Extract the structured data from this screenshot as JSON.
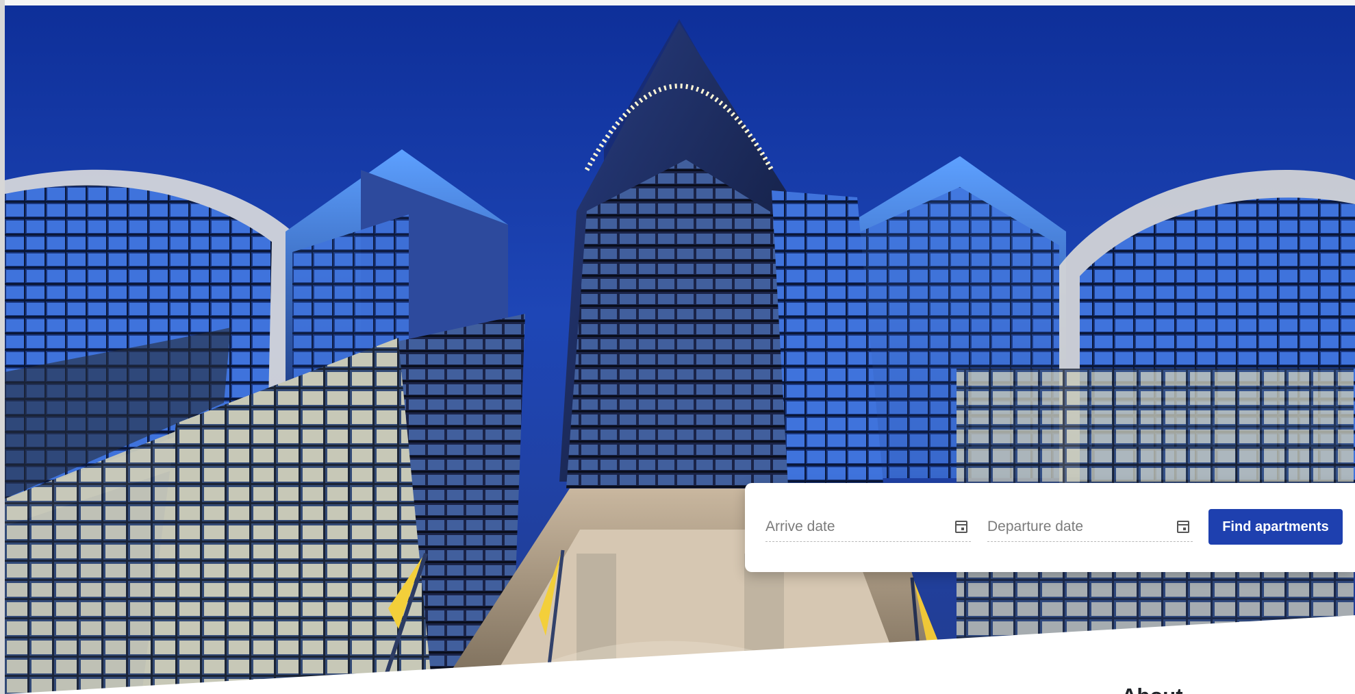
{
  "booking_widget": {
    "arrive_placeholder": "Arrive date",
    "departure_placeholder": "Departure date",
    "find_button": "Find apartments"
  },
  "section": {
    "about_title": "About"
  },
  "icons": {
    "arrive_calendar": "calendar-icon",
    "departure_calendar": "calendar-icon"
  },
  "colors": {
    "accent": "#1e40af",
    "card_background": "#ffffff",
    "sky": "#0f2f97"
  }
}
